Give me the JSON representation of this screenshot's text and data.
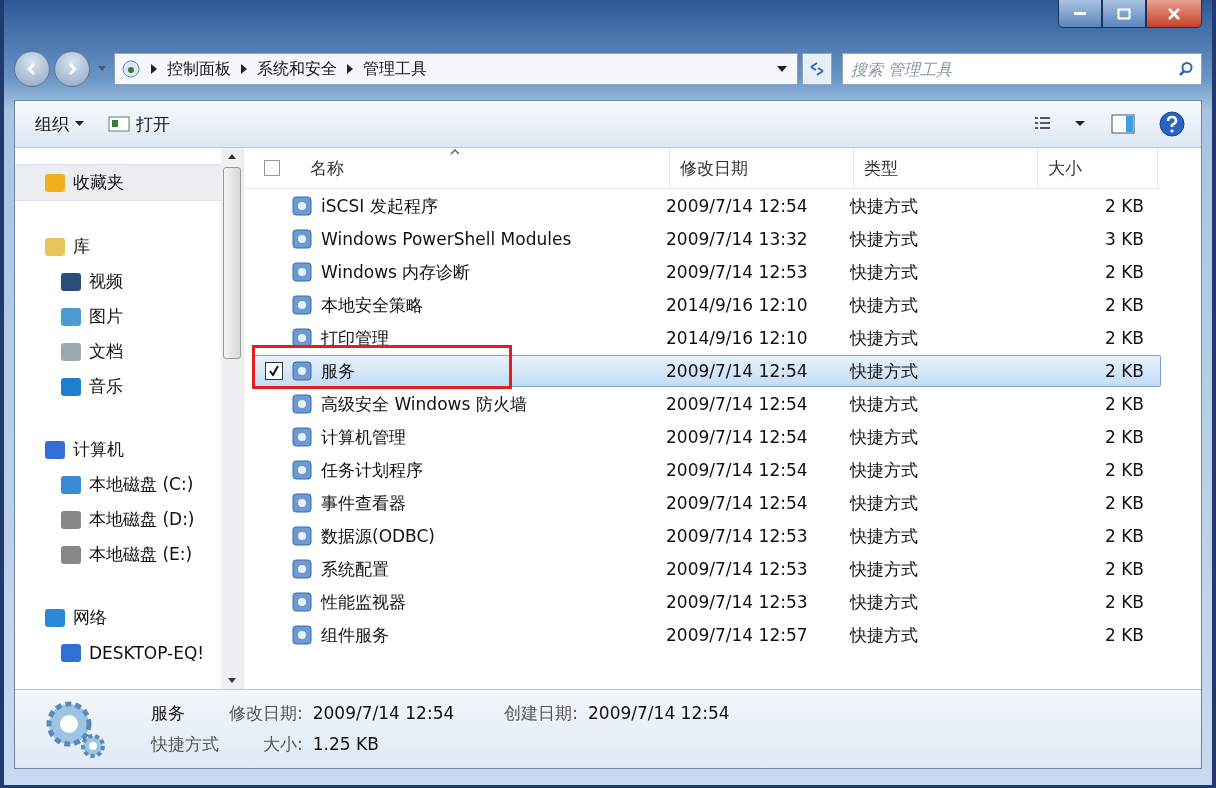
{
  "address": {
    "crumbs": [
      "控制面板",
      "系统和安全",
      "管理工具"
    ]
  },
  "search": {
    "placeholder": "搜索 管理工具"
  },
  "toolbar": {
    "organize": "组织",
    "open": "打开"
  },
  "sidebar": {
    "groups": [
      {
        "label": "收藏夹",
        "selected": true
      },
      {
        "label": "库",
        "selected": false,
        "children": [
          {
            "label": "视频"
          },
          {
            "label": "图片"
          },
          {
            "label": "文档"
          },
          {
            "label": "音乐"
          }
        ]
      },
      {
        "label": "计算机",
        "selected": false,
        "children": [
          {
            "label": "本地磁盘 (C:)"
          },
          {
            "label": "本地磁盘 (D:)"
          },
          {
            "label": "本地磁盘 (E:)"
          }
        ]
      },
      {
        "label": "网络",
        "selected": false,
        "children": [
          {
            "label": "DESKTOP-EQ!"
          }
        ]
      }
    ]
  },
  "table": {
    "select_all": {
      "checked": false
    },
    "columns": [
      {
        "label": "名称",
        "sorted": true
      },
      {
        "label": "修改日期",
        "sorted": false
      },
      {
        "label": "类型",
        "sorted": false
      },
      {
        "label": "大小",
        "sorted": false
      }
    ],
    "rows": [
      {
        "name": "iSCSI 发起程序",
        "date": "2009/7/14 12:54",
        "type": "快捷方式",
        "size": "2 KB",
        "selected": false,
        "highlighted": false
      },
      {
        "name": "Windows PowerShell Modules",
        "date": "2009/7/14 13:32",
        "type": "快捷方式",
        "size": "3 KB",
        "selected": false,
        "highlighted": false
      },
      {
        "name": "Windows 内存诊断",
        "date": "2009/7/14 12:53",
        "type": "快捷方式",
        "size": "2 KB",
        "selected": false,
        "highlighted": false
      },
      {
        "name": "本地安全策略",
        "date": "2014/9/16 12:10",
        "type": "快捷方式",
        "size": "2 KB",
        "selected": false,
        "highlighted": false
      },
      {
        "name": "打印管理",
        "date": "2014/9/16 12:10",
        "type": "快捷方式",
        "size": "2 KB",
        "selected": false,
        "highlighted": false
      },
      {
        "name": "服务",
        "date": "2009/7/14 12:54",
        "type": "快捷方式",
        "size": "2 KB",
        "selected": true,
        "highlighted": true
      },
      {
        "name": "高级安全 Windows 防火墙",
        "date": "2009/7/14 12:54",
        "type": "快捷方式",
        "size": "2 KB",
        "selected": false,
        "highlighted": false
      },
      {
        "name": "计算机管理",
        "date": "2009/7/14 12:54",
        "type": "快捷方式",
        "size": "2 KB",
        "selected": false,
        "highlighted": false
      },
      {
        "name": "任务计划程序",
        "date": "2009/7/14 12:54",
        "type": "快捷方式",
        "size": "2 KB",
        "selected": false,
        "highlighted": false
      },
      {
        "name": "事件查看器",
        "date": "2009/7/14 12:54",
        "type": "快捷方式",
        "size": "2 KB",
        "selected": false,
        "highlighted": false
      },
      {
        "name": "数据源(ODBC)",
        "date": "2009/7/14 12:53",
        "type": "快捷方式",
        "size": "2 KB",
        "selected": false,
        "highlighted": false
      },
      {
        "name": "系统配置",
        "date": "2009/7/14 12:53",
        "type": "快捷方式",
        "size": "2 KB",
        "selected": false,
        "highlighted": false
      },
      {
        "name": "性能监视器",
        "date": "2009/7/14 12:53",
        "type": "快捷方式",
        "size": "2 KB",
        "selected": false,
        "highlighted": false
      },
      {
        "name": "组件服务",
        "date": "2009/7/14 12:57",
        "type": "快捷方式",
        "size": "2 KB",
        "selected": false,
        "highlighted": false
      }
    ]
  },
  "details": {
    "name": "服务",
    "type": "快捷方式",
    "modified_label": "修改日期:",
    "modified": "2009/7/14 12:54",
    "created_label": "创建日期:",
    "created": "2009/7/14 12:54",
    "size_label": "大小:",
    "size": "1.25 KB"
  }
}
